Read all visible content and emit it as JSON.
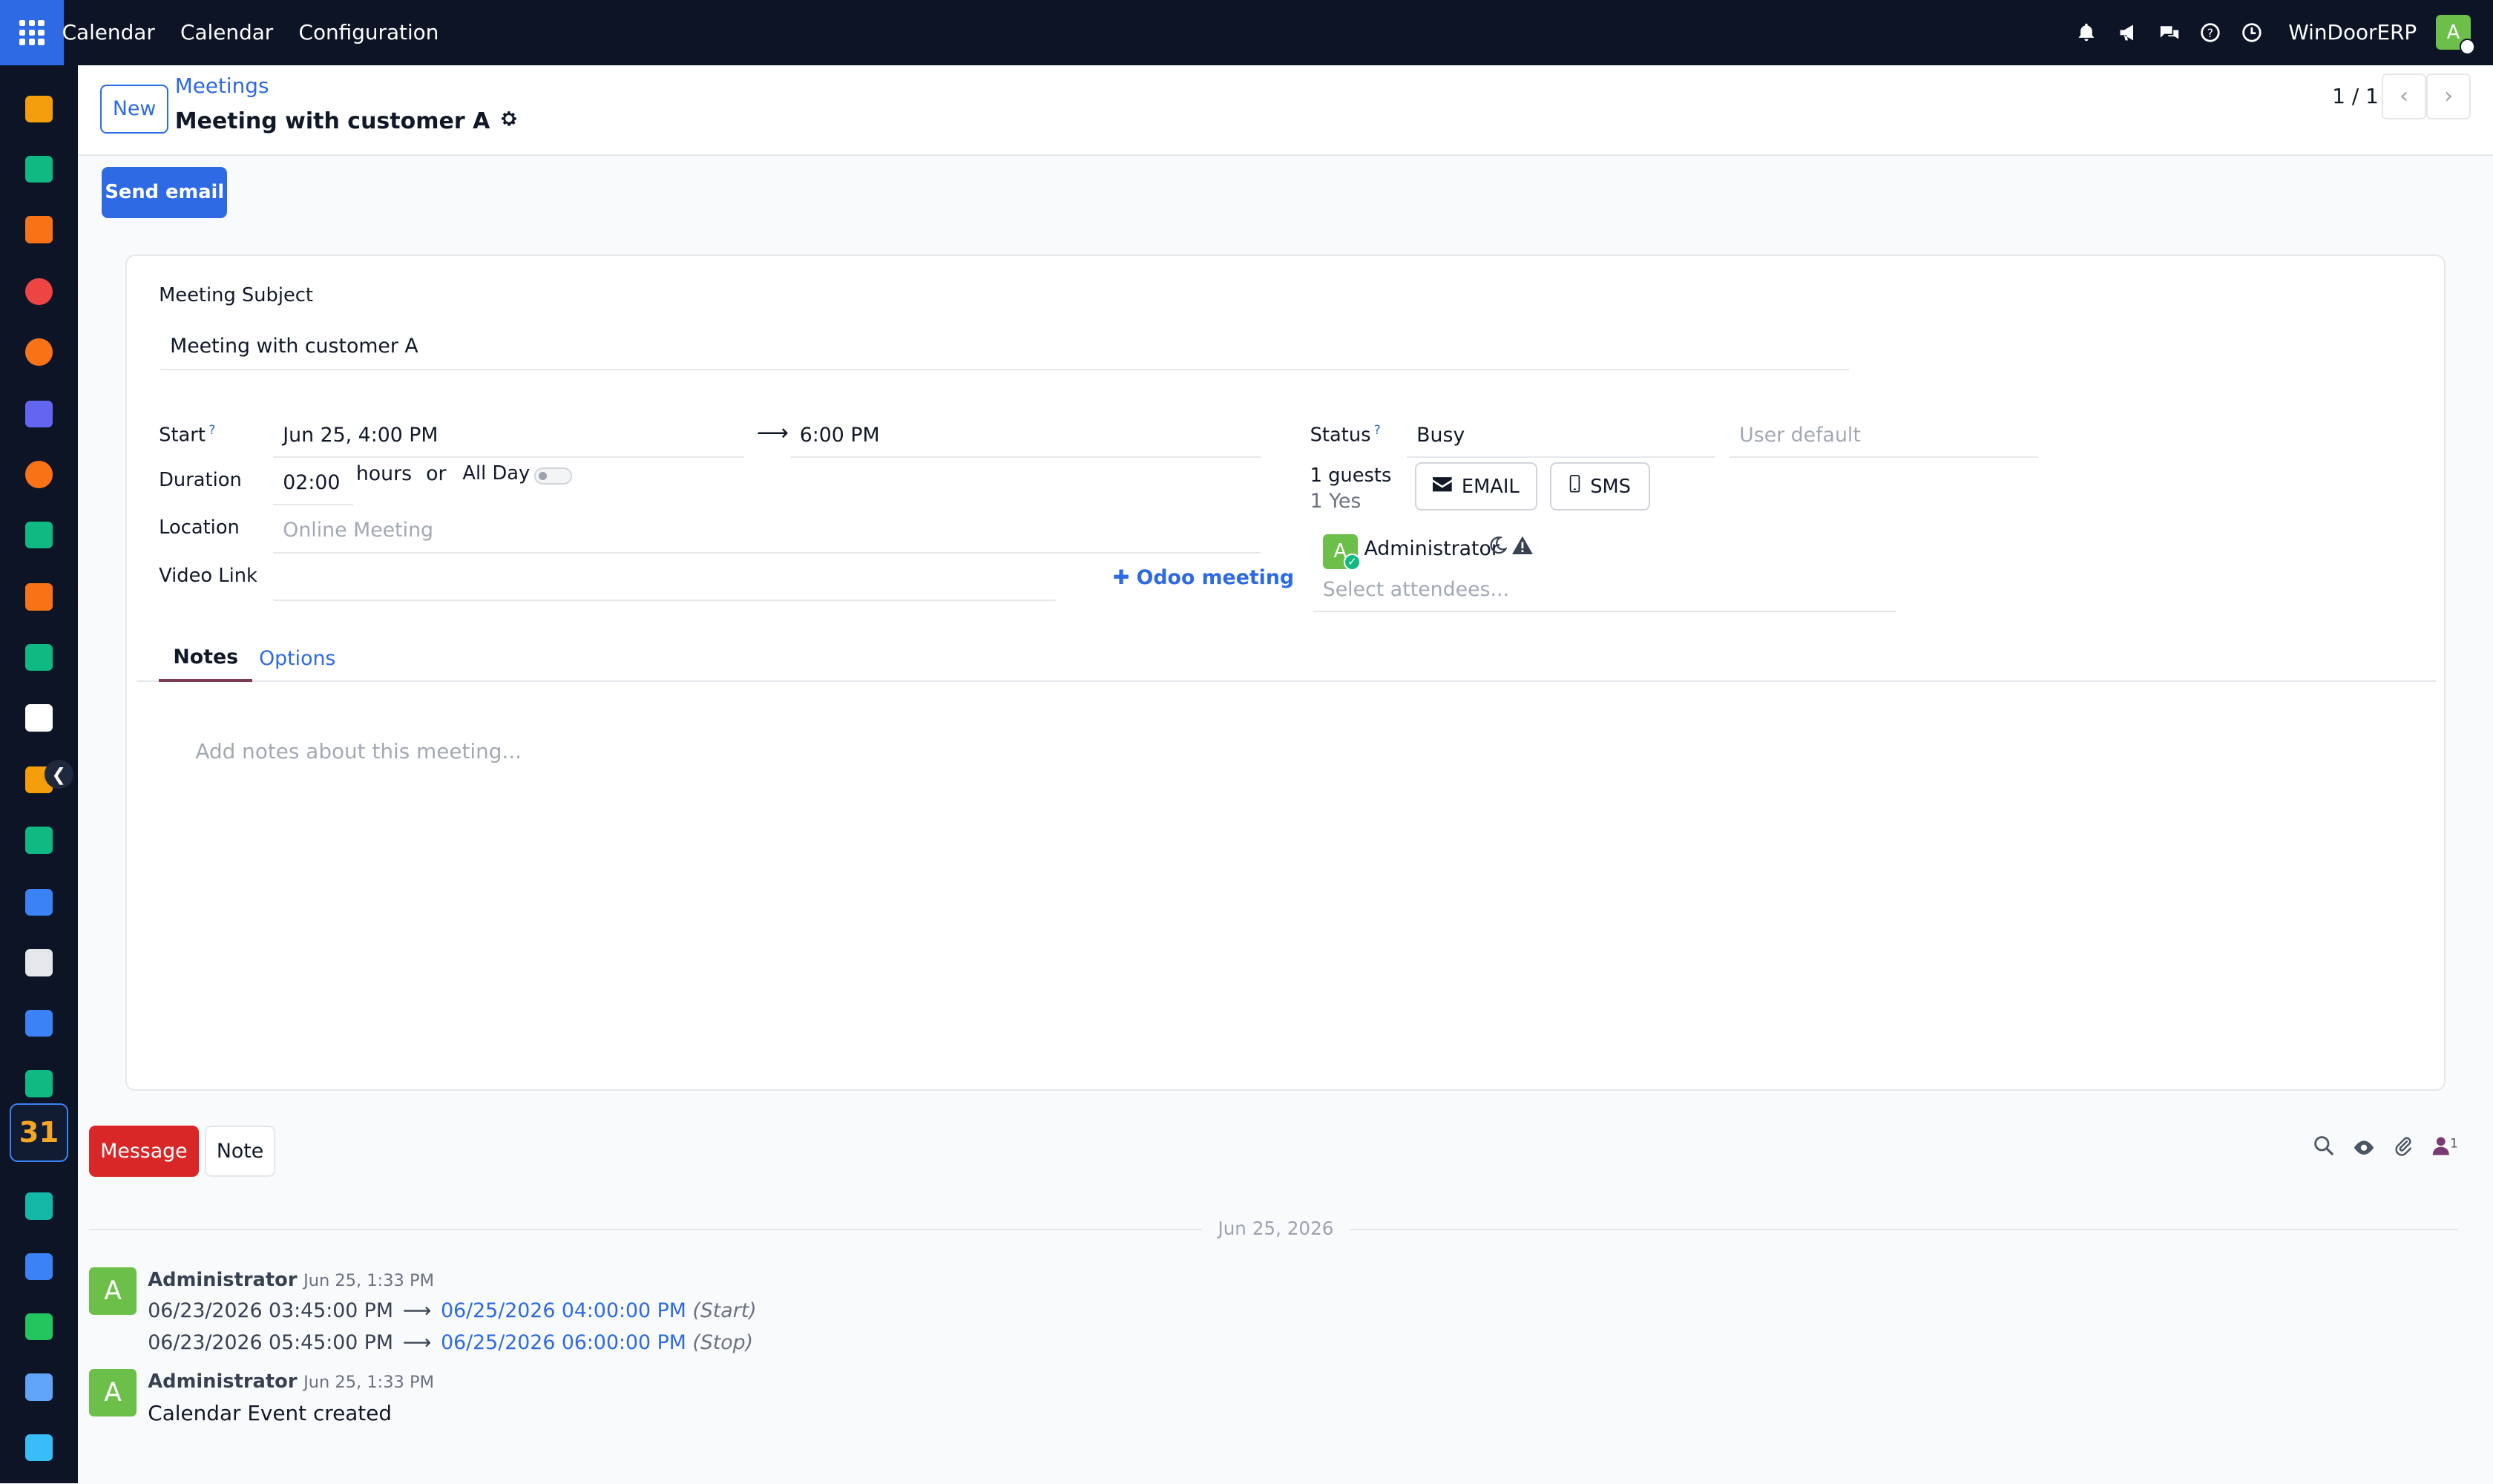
{
  "navbar": {
    "app_name": "Calendar",
    "menu": [
      "Calendar",
      "Configuration"
    ],
    "company": "WinDoorERP",
    "avatar_initial": "A"
  },
  "sidebar": {
    "active_app_label": "31",
    "apps": [
      {
        "icon": "expenses-icon",
        "color": "#f59e0b"
      },
      {
        "icon": "contacts-icon",
        "color": "#10b981"
      },
      {
        "icon": "dashboards-icon",
        "color": "#f97316"
      },
      {
        "icon": "project-icon",
        "color": "#ef4444"
      },
      {
        "icon": "discuss-icon",
        "color": "#f97316"
      },
      {
        "icon": "email-marketing-icon",
        "color": "#6366f1"
      },
      {
        "icon": "livechat-icon",
        "color": "#f97316"
      },
      {
        "icon": "crm-icon",
        "color": "#10b981"
      },
      {
        "icon": "sales-icon",
        "color": "#f97316"
      },
      {
        "icon": "employees-icon",
        "color": "#10b981"
      },
      {
        "icon": "inventory-icon",
        "color": "#ffffff"
      },
      {
        "icon": "purchase-icon",
        "color": "#f59e0b"
      },
      {
        "icon": "todo-icon",
        "color": "#10b981"
      },
      {
        "icon": "knowledge-icon",
        "color": "#3b82f6"
      },
      {
        "icon": "manufacturing-icon",
        "color": "#e5e7eb"
      },
      {
        "icon": "invoicing-icon",
        "color": "#3b82f6"
      },
      {
        "icon": "team-icon",
        "color": "#10b981"
      },
      {
        "icon": "sign-icon",
        "color": "#14b8a6"
      },
      {
        "icon": "apps-icon",
        "color": "#3b82f6"
      },
      {
        "icon": "whatsapp-icon",
        "color": "#22c55e"
      },
      {
        "icon": "timer-icon",
        "color": "#60a5fa"
      },
      {
        "icon": "website-icon",
        "color": "#38bdf8"
      }
    ]
  },
  "control": {
    "new_label": "New",
    "breadcrumb": "Meetings",
    "title": "Meeting with customer A",
    "pager": "1 / 1"
  },
  "actions": {
    "send_email": "Send email"
  },
  "form": {
    "subject_label": "Meeting Subject",
    "subject_value": "Meeting with customer A",
    "start_label": "Start",
    "start_value": "Jun 25, 4:00 PM",
    "stop_value": "6:00 PM",
    "duration_label": "Duration",
    "duration_value": "02:00",
    "hours_label": "hours",
    "or_label": "or",
    "allday_label": "All Day",
    "location_label": "Location",
    "location_placeholder": "Online Meeting",
    "video_label": "Video Link",
    "odoo_meeting": "Odoo meeting",
    "status_label": "Status",
    "status_value": "Busy",
    "privacy_placeholder": "User default",
    "guests_count": "1 guests",
    "guests_yes": "1 Yes",
    "email_btn": "EMAIL",
    "sms_btn": "SMS",
    "attendee_initial": "A",
    "attendee_name": "Administrator",
    "attendees_placeholder": "Select attendees...",
    "tabs": [
      "Notes",
      "Options"
    ],
    "notes_placeholder": "Add notes about this meeting..."
  },
  "chatter": {
    "message_btn": "Message",
    "note_btn": "Note",
    "followers_count": "1",
    "date_separator": "Jun 25, 2026",
    "messages": [
      {
        "author": "Administrator",
        "date": "Jun 25, 1:33 PM",
        "initial": "A",
        "tracking": [
          {
            "old": "06/23/2026 03:45:00 PM",
            "new": "06/25/2026 04:00:00 PM",
            "field": "(Start)"
          },
          {
            "old": "06/23/2026 05:45:00 PM",
            "new": "06/25/2026 06:00:00 PM",
            "field": "(Stop)"
          }
        ]
      },
      {
        "author": "Administrator",
        "date": "Jun 25, 1:33 PM",
        "initial": "A",
        "body": "Calendar Event created"
      }
    ]
  }
}
